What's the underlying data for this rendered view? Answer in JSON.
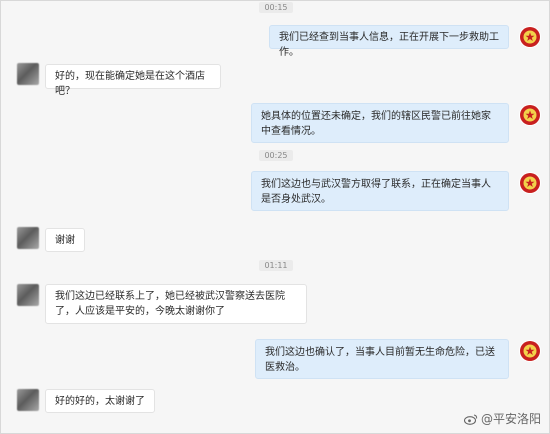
{
  "timestamps": [
    "00:15",
    "00:25",
    "01:11"
  ],
  "messages": [
    {
      "side": "right",
      "text": "我们已经查到当事人信息，正在开展下一步救助工作。"
    },
    {
      "side": "left",
      "text": "好的，现在能确定她是在这个酒店吧？"
    },
    {
      "side": "right",
      "text": "她具体的位置还未确定，我们的辖区民警已前往她家中查看情况。"
    },
    {
      "side": "right",
      "text": "我们这边也与武汉警方取得了联系，正在确定当事人是否身处武汉。"
    },
    {
      "side": "left",
      "text": "谢谢"
    },
    {
      "side": "left",
      "text": "我们这边已经联系上了，她已经被武汉警察送去医院了，人应该是平安的，今晚太谢谢你了"
    },
    {
      "side": "right",
      "text": "我们这边也确认了，当事人目前暂无生命危险，已送医救治。"
    },
    {
      "side": "left",
      "text": "好的好的，太谢谢了"
    }
  ],
  "watermark": "@平安洛阳",
  "colors": {
    "right_bubble": "#deedfb",
    "left_bubble": "#ffffff",
    "police_badge": "#c8201f"
  }
}
